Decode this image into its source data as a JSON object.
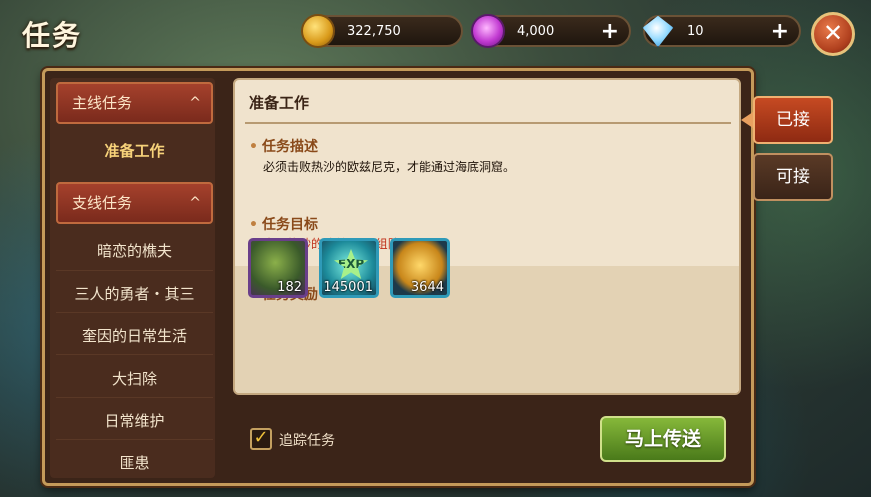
{
  "title": "任务",
  "resources": [
    {
      "icon": "gold-coin-icon",
      "value": "322,750",
      "has_plus": false
    },
    {
      "icon": "purple-gem-icon",
      "value": "4,000",
      "has_plus": true,
      "plus": "+"
    },
    {
      "icon": "diamond-icon",
      "value": "10",
      "has_plus": true,
      "plus": "+"
    }
  ],
  "close": "✕",
  "sidebar": {
    "main_category": "主线任务",
    "main_items": [
      "准备工作"
    ],
    "side_category": "支线任务",
    "side_items": [
      "暗恋的樵夫",
      "三人的勇者・其三",
      "奎因的日常生活",
      "大扫除",
      "日常维护",
      "匪患"
    ],
    "chevron": "^"
  },
  "quest": {
    "name": "准备工作",
    "description_heading": "任务描述",
    "description": "必须击败热沙的欧兹尼克，才能通过海底洞窟。",
    "goal_heading": "任务目标",
    "goal": "击败热砂的欧兹尼克(组队)",
    "reward_heading": "任务奖励",
    "rewards": [
      {
        "icon": "plant-item-icon",
        "amount": "182"
      },
      {
        "icon": "exp-star-icon",
        "amount": "145001",
        "label": "EXP"
      },
      {
        "icon": "gold-coin-icon",
        "amount": "3644"
      }
    ]
  },
  "tabs": {
    "accepted": "已接",
    "available": "可接"
  },
  "track": {
    "label": "追踪任务",
    "checked": true,
    "mark": "✓"
  },
  "teleport_label": "马上传送",
  "colors": {
    "accent_red": "#b0401e",
    "accent_green": "#6a9a2a",
    "frame_gold": "#c49a5a"
  }
}
